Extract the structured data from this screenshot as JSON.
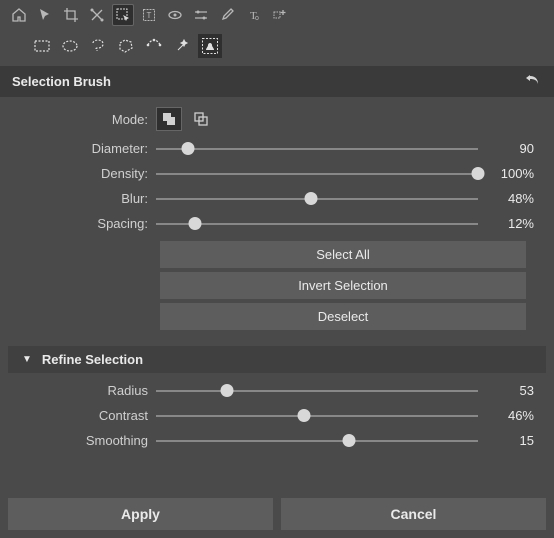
{
  "panel_title": "Selection Brush",
  "mode_label": "Mode:",
  "sliders": {
    "diameter": {
      "label": "Diameter:",
      "value": "90",
      "pct": 10
    },
    "density": {
      "label": "Density:",
      "value": "100%",
      "pct": 100
    },
    "blur": {
      "label": "Blur:",
      "value": "48%",
      "pct": 48
    },
    "spacing": {
      "label": "Spacing:",
      "value": "12%",
      "pct": 12
    }
  },
  "actions": {
    "select_all": "Select All",
    "invert": "Invert Selection",
    "deselect": "Deselect"
  },
  "refine": {
    "title": "Refine Selection",
    "radius": {
      "label": "Radius",
      "value": "53",
      "pct": 22
    },
    "contrast": {
      "label": "Contrast",
      "value": "46%",
      "pct": 46
    },
    "smoothing": {
      "label": "Smoothing",
      "value": "15",
      "pct": 60
    }
  },
  "bottom": {
    "apply": "Apply",
    "cancel": "Cancel"
  }
}
